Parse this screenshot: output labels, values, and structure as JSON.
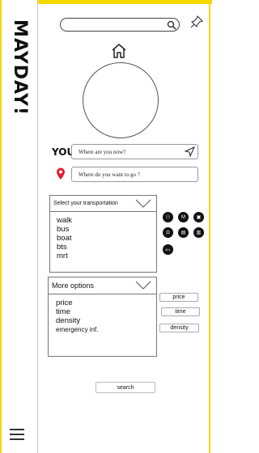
{
  "brand": {
    "name": "MAYDAY!",
    "color": "#f5d800"
  },
  "search": {
    "value": "",
    "icon": "search-icon"
  },
  "header": {
    "pin_icon": "pin-icon",
    "home_icon": "home-icon"
  },
  "route": {
    "you_label": "YOU",
    "from_placeholder": "Where are you now?",
    "to_placeholder": "Where do you want to go ?"
  },
  "transport": {
    "header": "Select your transportation",
    "options": [
      "walk",
      "bus",
      "boat",
      "bts",
      "mrt"
    ],
    "mode_icons": [
      {
        "name": "walk-mode-icon",
        "glyph": "⚇"
      },
      {
        "name": "mrt-mode-icon",
        "glyph": "M"
      },
      {
        "name": "bus-mode-icon",
        "glyph": "▣"
      },
      {
        "name": "bts-mode-icon",
        "glyph": "Ω"
      },
      {
        "name": "boat-mode-icon",
        "glyph": "▤"
      },
      {
        "name": "train-mode-icon",
        "glyph": "▥"
      },
      {
        "name": "all-mode-icon",
        "glyph": "ALL"
      }
    ]
  },
  "options": {
    "header": "More options",
    "items": [
      "price",
      "time",
      "density",
      "emergency inf."
    ]
  },
  "filters": {
    "price": "price",
    "time": "time",
    "density": "density"
  },
  "actions": {
    "search_label": "search"
  }
}
